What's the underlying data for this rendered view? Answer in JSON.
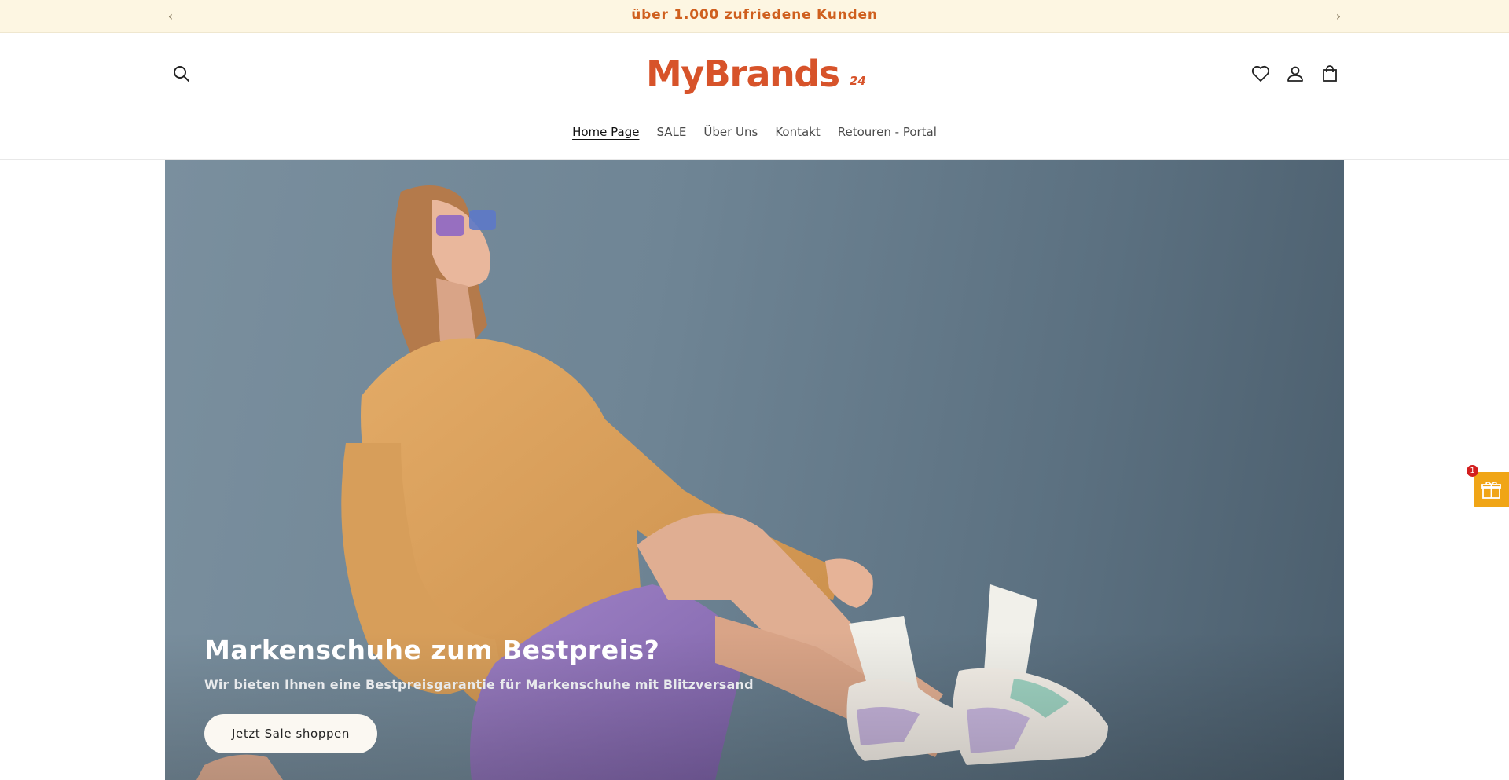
{
  "announcement": {
    "text": "über 1.000 zufriedene Kunden",
    "prev_icon": "chevron-left-icon",
    "next_icon": "chevron-right-icon"
  },
  "header": {
    "logo_main": "MyBrands",
    "logo_sub": "24",
    "icons": [
      "search-icon",
      "heart-icon",
      "user-icon",
      "shopping-bag-icon"
    ],
    "nav": [
      {
        "label": "Home Page",
        "active": true
      },
      {
        "label": "SALE",
        "active": false
      },
      {
        "label": "Über Uns",
        "active": false
      },
      {
        "label": "Kontakt",
        "active": false
      },
      {
        "label": "Retouren - Portal",
        "active": false
      }
    ]
  },
  "hero": {
    "title": "Markenschuhe zum Bestpreis?",
    "subtitle": "Wir bieten Ihnen eine Bestpreisgarantie für Markenschuhe mit Blitzversand",
    "cta": "Jetzt Sale shoppen"
  },
  "gift_widget": {
    "badge": "1",
    "icon": "gift-icon"
  },
  "colors": {
    "brand": "#d7532a",
    "announcement_bg": "#fdf6e2",
    "announcement_text": "#cf5f1e",
    "gift_widget": "#f0a516"
  }
}
